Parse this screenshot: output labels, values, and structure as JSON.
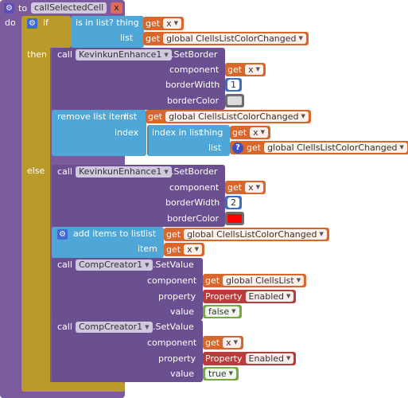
{
  "procedure": {
    "to_label": "to",
    "name": "callSelectedCell",
    "param": "x",
    "do_label": "do"
  },
  "if_block": {
    "if_label": "if",
    "then_label": "then",
    "else_label": "else"
  },
  "is_in_list": {
    "title": "is in list? thing",
    "list_label": "list",
    "thing_get": {
      "get_label": "get",
      "var": "x"
    },
    "list_get": {
      "get_label": "get",
      "var": "global ClellsListColorChanged"
    }
  },
  "then": {
    "setborder": {
      "call_label": "call",
      "component": "KevinkunEnhance1",
      "method": ".SetBorder",
      "component_label": "component",
      "borderwidth_label": "borderWidth",
      "bordercolor_label": "borderColor",
      "component_get": {
        "get_label": "get",
        "var": "x"
      },
      "borderwidth_value": "1",
      "bordercolor_hex": "#dcdcdc"
    },
    "remove_item": {
      "title": "remove list item",
      "list_label": "list",
      "index_label": "index",
      "list_get": {
        "get_label": "get",
        "var": "global ClellsListColorChanged"
      },
      "index_in_list": {
        "title": "index in list",
        "thing_label": "thing",
        "list_label": "list",
        "thing_get": {
          "get_label": "get",
          "var": "x"
        },
        "list_get": {
          "get_label": "get",
          "var": "global ClellsListColorChanged"
        }
      }
    }
  },
  "else": {
    "setborder": {
      "call_label": "call",
      "component": "KevinkunEnhance1",
      "method": ".SetBorder",
      "component_label": "component",
      "borderwidth_label": "borderWidth",
      "bordercolor_label": "borderColor",
      "component_get": {
        "get_label": "get",
        "var": "x"
      },
      "borderwidth_value": "2",
      "bordercolor_hex": "#ff0000"
    },
    "add_items": {
      "title": "add items to list",
      "list_label": "list",
      "item_label": "item",
      "list_get": {
        "get_label": "get",
        "var": "global ClellsListColorChanged"
      },
      "item_get": {
        "get_label": "get",
        "var": "x"
      }
    },
    "setvalue1": {
      "call_label": "call",
      "component": "CompCreator1",
      "method": ".SetValue",
      "component_label": "component",
      "property_label": "property",
      "value_label": "value",
      "component_get": {
        "get_label": "get",
        "var": "global ClellsList"
      },
      "property_prefix": "Property",
      "property_value": "Enabled",
      "value": "false"
    },
    "setvalue2": {
      "call_label": "call",
      "component": "CompCreator1",
      "method": ".SetValue",
      "component_label": "component",
      "property_label": "property",
      "value_label": "value",
      "component_get": {
        "get_label": "get",
        "var": "x"
      },
      "property_prefix": "Property",
      "property_value": "Enabled",
      "value": "true"
    }
  },
  "colors": {
    "procedure": "#7b5b9e",
    "control": "#b99a2b",
    "component": "#6a4f91",
    "list": "#4fa7d8",
    "variable": "#d9662a",
    "text": "#b83c3c",
    "logic": "#74aa3e",
    "math": "#3c6fbf"
  }
}
